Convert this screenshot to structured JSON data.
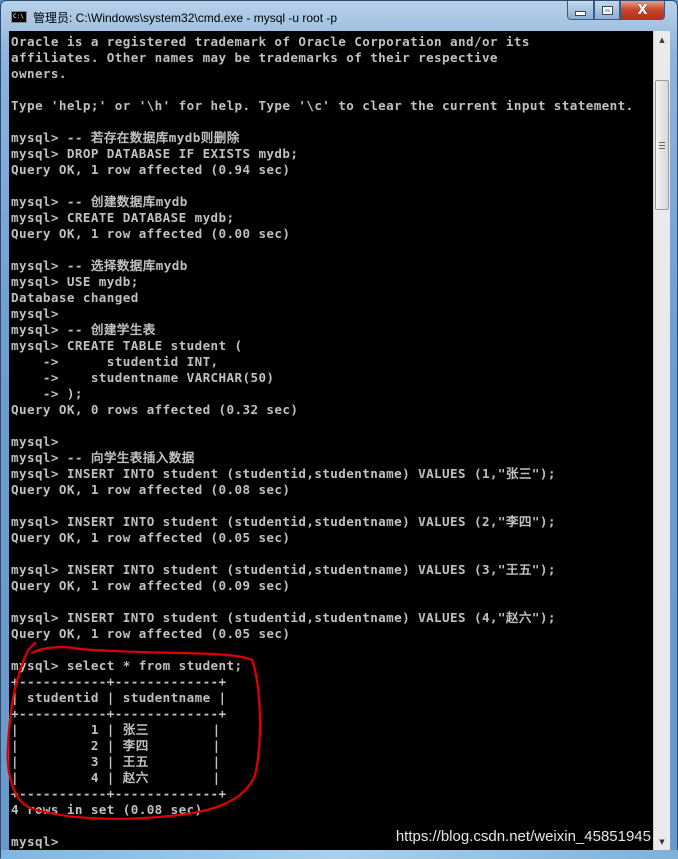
{
  "window": {
    "title": "管理员: C:\\Windows\\system32\\cmd.exe - mysql  -u root -p",
    "icon": "cmd-icon",
    "icon_label": "C:\\",
    "controls": {
      "minimize": "minimize-icon",
      "maximize": "maximize-icon",
      "close": "close-icon",
      "close_glyph": "X"
    }
  },
  "console": {
    "lines": [
      "Oracle is a registered trademark of Oracle Corporation and/or its",
      "affiliates. Other names may be trademarks of their respective",
      "owners.",
      "",
      "Type 'help;' or '\\h' for help. Type '\\c' to clear the current input statement.",
      "",
      "mysql> -- 若存在数据库mydb则删除",
      "mysql> DROP DATABASE IF EXISTS mydb;",
      "Query OK, 1 row affected (0.94 sec)",
      "",
      "mysql> -- 创建数据库mydb",
      "mysql> CREATE DATABASE mydb;",
      "Query OK, 1 row affected (0.00 sec)",
      "",
      "mysql> -- 选择数据库mydb",
      "mysql> USE mydb;",
      "Database changed",
      "mysql>",
      "mysql> -- 创建学生表",
      "mysql> CREATE TABLE student (",
      "    ->      studentid INT,",
      "    ->    studentname VARCHAR(50)",
      "    -> );",
      "Query OK, 0 rows affected (0.32 sec)",
      "",
      "mysql>",
      "mysql> -- 向学生表插入数据",
      "mysql> INSERT INTO student (studentid,studentname) VALUES (1,\"张三\");",
      "Query OK, 1 row affected (0.08 sec)",
      "",
      "mysql> INSERT INTO student (studentid,studentname) VALUES (2,\"李四\");",
      "Query OK, 1 row affected (0.05 sec)",
      "",
      "mysql> INSERT INTO student (studentid,studentname) VALUES (3,\"王五\");",
      "Query OK, 1 row affected (0.09 sec)",
      "",
      "mysql> INSERT INTO student (studentid,studentname) VALUES (4,\"赵六\");",
      "Query OK, 1 row affected (0.05 sec)",
      "",
      "mysql> select * from student;",
      "+-----------+-------------+",
      "| studentid | studentname |",
      "+-----------+-------------+",
      "|         1 | 张三        |",
      "|         2 | 李四        |",
      "|         3 | 王五        |",
      "|         4 | 赵六        |",
      "+-----------+-------------+",
      "4 rows in set (0.08 sec)",
      "",
      "mysql>"
    ],
    "result_table": {
      "columns": [
        "studentid",
        "studentname"
      ],
      "rows": [
        [
          "1",
          "张三"
        ],
        [
          "2",
          "李四"
        ],
        [
          "3",
          "王五"
        ],
        [
          "4",
          "赵六"
        ]
      ],
      "summary": "4 rows in set (0.08 sec)"
    }
  },
  "scrollbar": {
    "up_arrow": "▲",
    "down_arrow": "▼"
  },
  "annotation": {
    "type": "hand-drawn loop",
    "color": "#e00000",
    "encloses": "select result"
  },
  "watermark": "https://blog.csdn.net/weixin_45851945"
}
